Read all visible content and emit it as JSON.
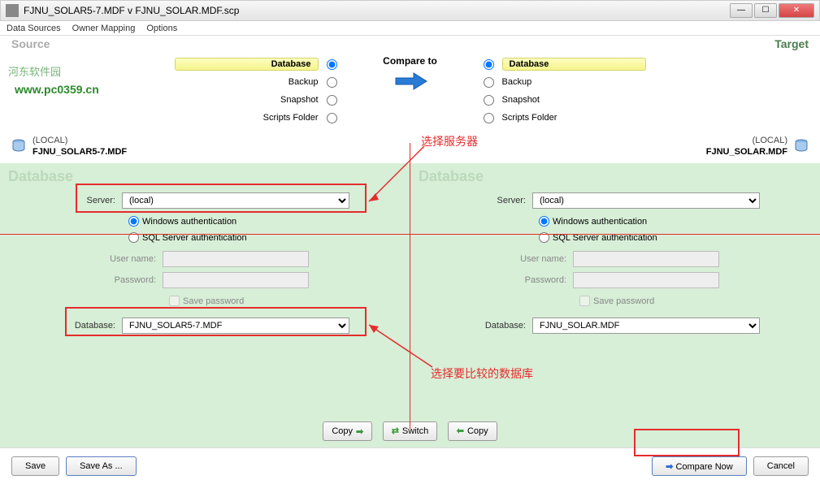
{
  "window": {
    "title": "FJNU_SOLAR5-7.MDF v FJNU_SOLAR.MDF.scp"
  },
  "menu": {
    "items": [
      "Data Sources",
      "Owner Mapping",
      "Options"
    ]
  },
  "watermark": {
    "site": "河东软件园",
    "url": "www.pc0359.cn"
  },
  "labels": {
    "source": "Source",
    "target": "Target",
    "compare_to": "Compare to",
    "database_wm": "Database"
  },
  "source_types": {
    "database": "Database",
    "backup": "Backup",
    "snapshot": "Snapshot",
    "scripts": "Scripts Folder"
  },
  "source_info": {
    "server": "(LOCAL)",
    "db": "FJNU_SOLAR5-7.MDF"
  },
  "target_info": {
    "server": "(LOCAL)",
    "db": "FJNU_SOLAR.MDF"
  },
  "form": {
    "server_label": "Server:",
    "win_auth": "Windows authentication",
    "sql_auth": "SQL Server authentication",
    "user_label": "User name:",
    "pass_label": "Password:",
    "save_pass": "Save password",
    "db_label": "Database:"
  },
  "source_form": {
    "server": "(local)",
    "database": "FJNU_SOLAR5-7.MDF"
  },
  "target_form": {
    "server": "(local)",
    "database": "FJNU_SOLAR.MDF"
  },
  "buttons": {
    "copy": "Copy",
    "switch": "Switch",
    "save": "Save",
    "save_as": "Save As ...",
    "compare_now": "Compare Now",
    "cancel": "Cancel"
  },
  "annotations": {
    "select_server": "选择服务器",
    "select_db": "选择要比较的数据库"
  }
}
